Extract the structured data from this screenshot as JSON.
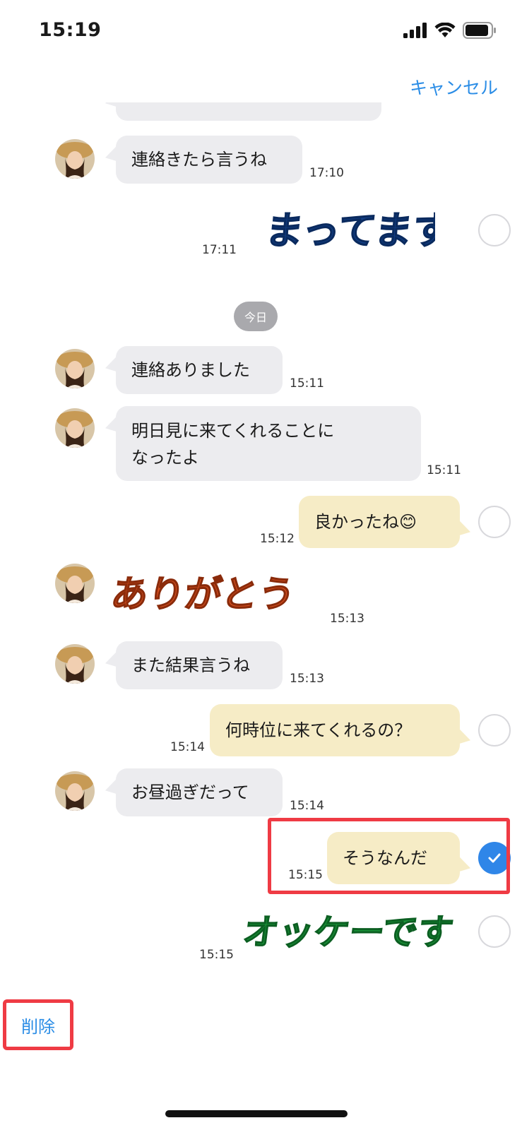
{
  "status_bar": {
    "time": "15:19"
  },
  "header": {
    "cancel_label": "キャンセル"
  },
  "chat": {
    "date_separator": "今日",
    "messages": [
      {
        "type": "text",
        "direction": "in",
        "text": "連絡きたら言うね",
        "time": "17:10"
      },
      {
        "type": "sticker",
        "direction": "out",
        "text": "まってます",
        "time": "17:11",
        "selected": false
      },
      {
        "type": "text",
        "direction": "in",
        "text": "連絡ありました",
        "time": "15:11"
      },
      {
        "type": "text",
        "direction": "in",
        "text": "明日見に来てくれることに\nなったよ",
        "time": "15:11"
      },
      {
        "type": "text",
        "direction": "out",
        "text": "良かったね😊",
        "time": "15:12",
        "selected": false
      },
      {
        "type": "sticker",
        "direction": "in",
        "text": "ありがとう",
        "time": "15:13"
      },
      {
        "type": "text",
        "direction": "in",
        "text": "また結果言うね",
        "time": "15:13"
      },
      {
        "type": "text",
        "direction": "out",
        "text": "何時位に来てくれるの？",
        "time": "15:14",
        "selected": false
      },
      {
        "type": "text",
        "direction": "in",
        "text": "お昼過ぎだって",
        "time": "15:14"
      },
      {
        "type": "text",
        "direction": "out",
        "text": "そうなんだ",
        "time": "15:15",
        "selected": true
      },
      {
        "type": "sticker",
        "direction": "out",
        "text": "オッケーです",
        "time": "15:15",
        "selected": false
      }
    ]
  },
  "footer": {
    "delete_label": "削除"
  },
  "colors": {
    "accent": "#2b8de6",
    "highlight": "#ef3b44",
    "outgoing_bubble": "#f6ecc6",
    "incoming_bubble": "#ececef"
  }
}
